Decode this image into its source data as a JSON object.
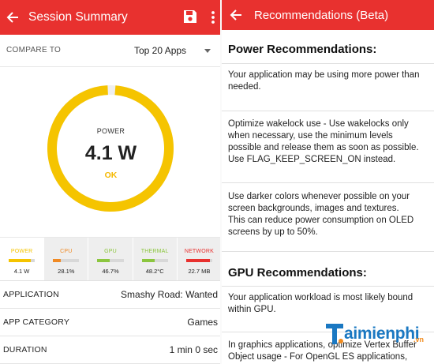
{
  "left": {
    "appbar": {
      "title": "Session Summary"
    },
    "compare": {
      "label": "COMPARE TO",
      "value": "Top 20 Apps"
    },
    "gauge": {
      "title": "POWER",
      "value": "4.1 W",
      "status": "OK",
      "fraction": 0.98,
      "color": "#f5c400",
      "status_color": "#f5b800"
    },
    "metrics": [
      {
        "label": "POWER",
        "value": "4.1 W",
        "color": "#f5c400",
        "fill": 0.85
      },
      {
        "label": "CPU",
        "value": "28.1%",
        "color": "#f08a24",
        "fill": 0.28
      },
      {
        "label": "GPU",
        "value": "46.7%",
        "color": "#8cc63f",
        "fill": 0.47
      },
      {
        "label": "THERMAL",
        "value": "48.2°C",
        "color": "#8cc63f",
        "fill": 0.48
      },
      {
        "label": "NETWORK",
        "value": "22.7 MB",
        "color": "#e8312f",
        "fill": 0.9
      }
    ],
    "info": [
      {
        "key": "APPLICATION",
        "value": "Smashy Road: Wanted"
      },
      {
        "key": "APP CATEGORY",
        "value": "Games"
      },
      {
        "key": "DURATION",
        "value": "1 min 0 sec"
      }
    ]
  },
  "right": {
    "appbar": {
      "title": "Recommendations (Beta)"
    },
    "power": {
      "title": "Power Recommendations:",
      "items": [
        [
          "Your application may be using more power than",
          "needed."
        ],
        [
          "Optimize wakelock use - Use wakelocks only",
          "when necessary, use the minimum levels",
          "possible and release them as soon as possible.",
          "Use FLAG_KEEP_SCREEN_ON instead."
        ],
        [
          "Use darker colors whenever possible on your",
          "screen backgrounds, images and textures.",
          "This can reduce power consumption on OLED",
          "screens by up to 50%."
        ]
      ]
    },
    "gpu": {
      "title": "GPU Recommendations:",
      "items": [
        [
          "Your application workload is most likely bound",
          "within GPU."
        ],
        [
          "In graphics applications, optimize Vertex Buffer",
          "Object usage - For OpenGL ES applications,"
        ]
      ]
    }
  },
  "watermark": {
    "brand": "aimienphi",
    "suffix": ".vn",
    "brand_color": "#1a78c2",
    "suffix_color": "#f28c1e"
  },
  "colors": {
    "appbar": "#e8312f"
  }
}
